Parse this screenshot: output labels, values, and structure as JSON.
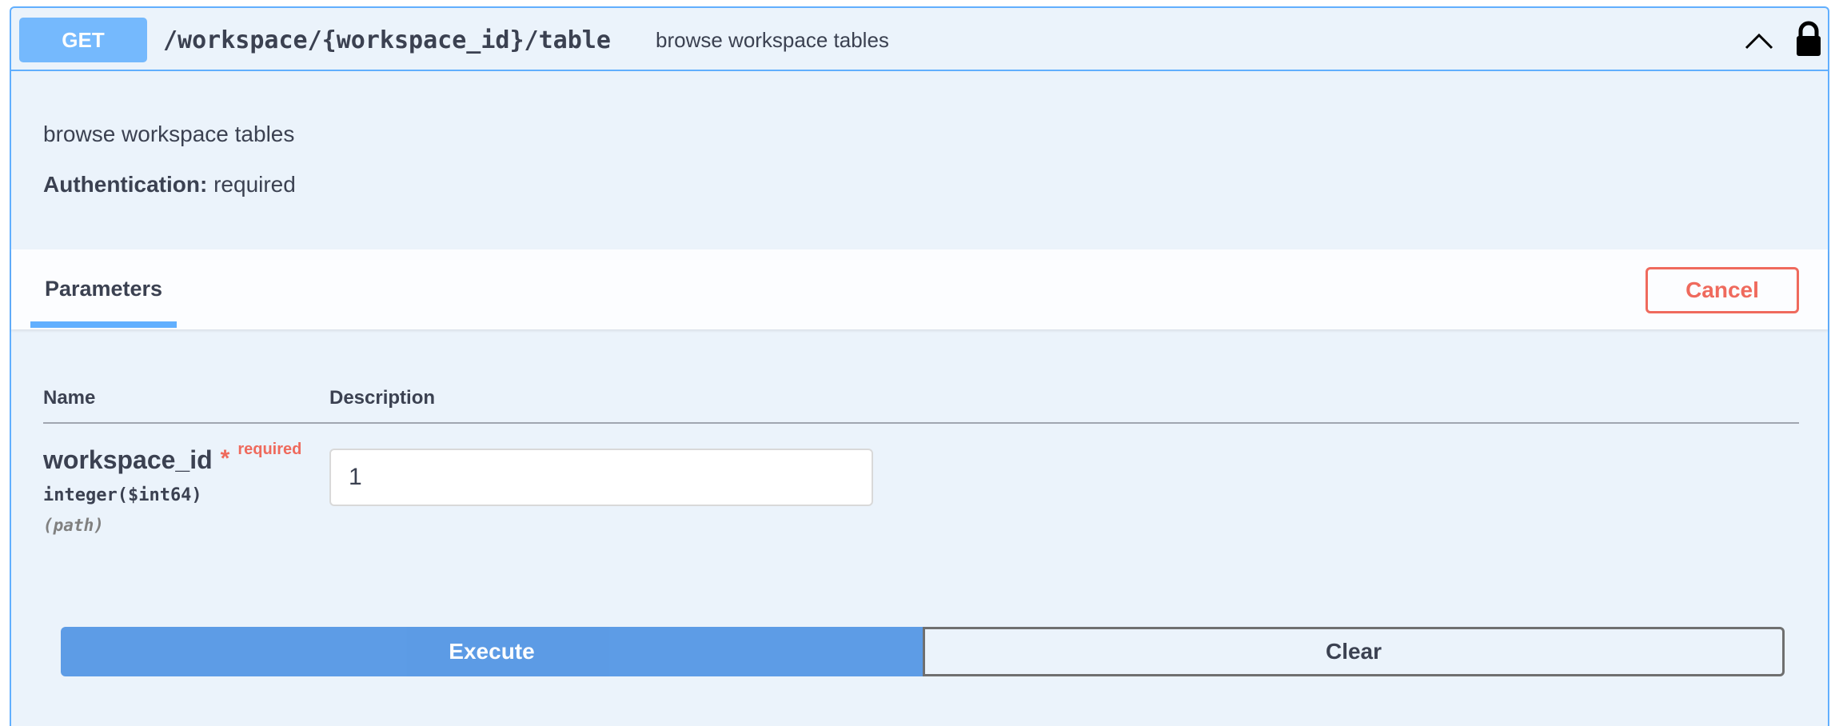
{
  "operation": {
    "method": "GET",
    "path": "/workspace/{workspace_id}/table",
    "summary": "browse workspace tables",
    "description": "browse workspace tables",
    "auth_label": "Authentication:",
    "auth_value": "required",
    "collapse_icon": "chevron-up-icon",
    "lock_icon": "lock-icon",
    "colors": {
      "method": "#61affe",
      "background": "#ebf3fb",
      "required": "#ef6a5d",
      "execute": "#4990e2"
    }
  },
  "params": {
    "tab_label": "Parameters",
    "cancel_label": "Cancel",
    "headers": {
      "name": "Name",
      "description": "Description"
    },
    "items": [
      {
        "name": "workspace_id",
        "star": "*",
        "required_label": "required",
        "type": "integer($int64)",
        "in": "(path)",
        "value": "1"
      }
    ]
  },
  "actions": {
    "execute_label": "Execute",
    "clear_label": "Clear"
  }
}
